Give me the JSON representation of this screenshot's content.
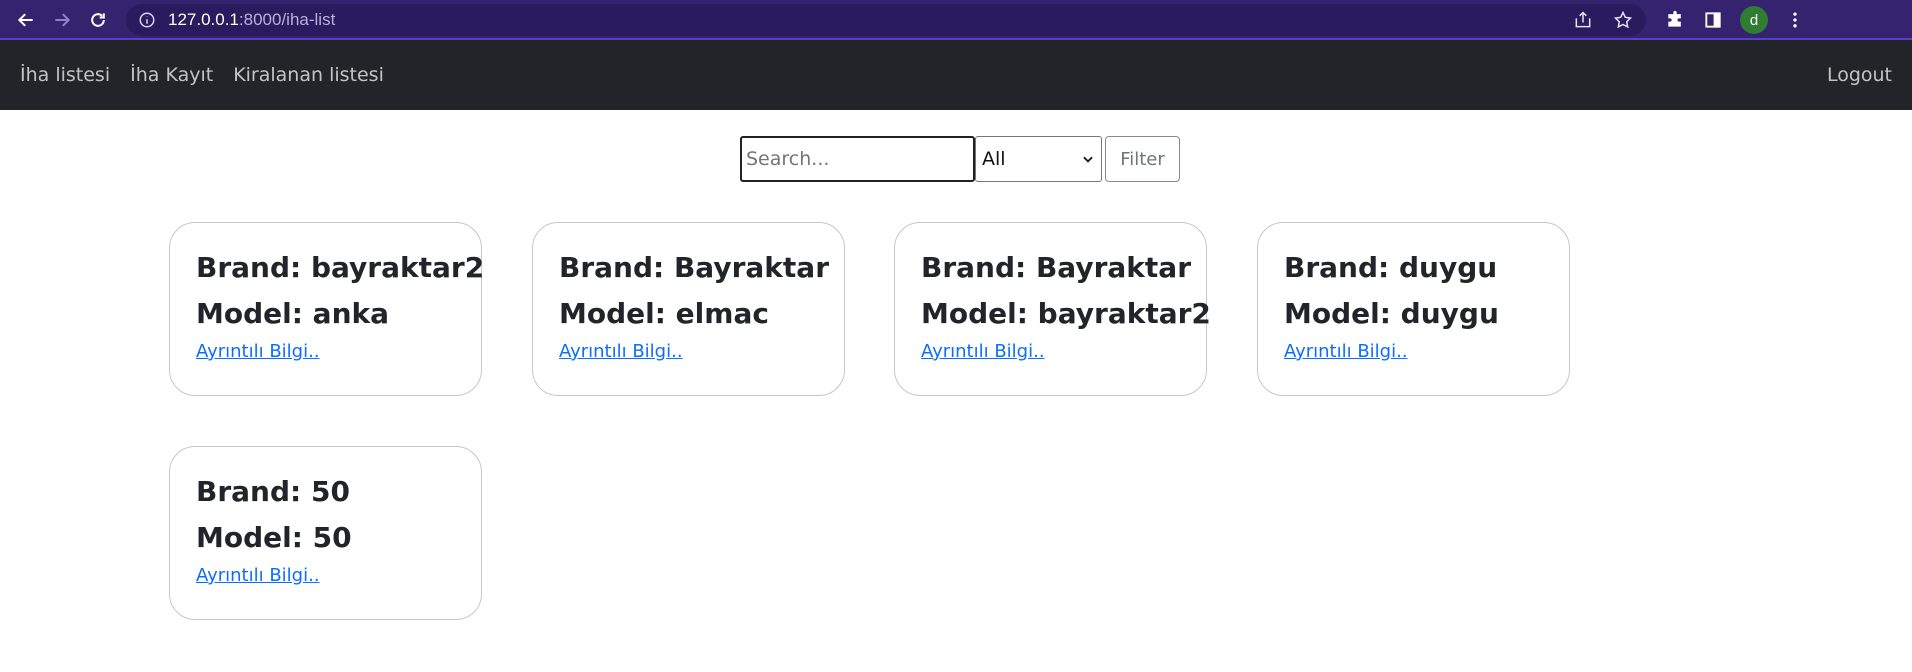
{
  "browser": {
    "url_host": "127.0.0.1",
    "url_rest": ":8000/iha-list",
    "avatar_letter": "d"
  },
  "nav": {
    "links": [
      "İha listesi",
      "İha Kayıt",
      "Kiralanan listesi"
    ],
    "logout": "Logout"
  },
  "filter": {
    "search_placeholder": "Search...",
    "select_value": "All",
    "button_label": "Filter"
  },
  "cards": [
    {
      "brand": "Brand: bayraktar2",
      "model": "Model: anka",
      "link": "Ayrıntılı Bilgi.."
    },
    {
      "brand": "Brand: Bayraktar",
      "model": "Model: elmac",
      "link": "Ayrıntılı Bilgi.."
    },
    {
      "brand": "Brand: Bayraktar",
      "model": "Model: bayraktar2",
      "link": "Ayrıntılı Bilgi.."
    },
    {
      "brand": "Brand: duygu",
      "model": "Model: duygu",
      "link": "Ayrıntılı Bilgi.."
    },
    {
      "brand": "Brand: 50",
      "model": "Model: 50",
      "link": "Ayrıntılı Bilgi.."
    }
  ]
}
